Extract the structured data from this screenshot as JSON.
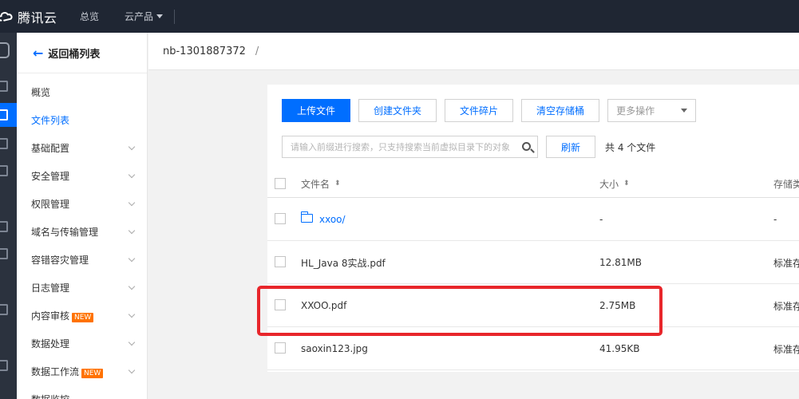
{
  "topbar": {
    "logo_text": "腾讯云",
    "nav_overview": "总览",
    "nav_products": "云产品"
  },
  "sidebar": {
    "back_label": "返回桶列表",
    "items": [
      {
        "label": "概览"
      },
      {
        "label": "文件列表",
        "active": true
      },
      {
        "label": "基础配置"
      },
      {
        "label": "安全管理"
      },
      {
        "label": "权限管理"
      },
      {
        "label": "域名与传输管理"
      },
      {
        "label": "容错容灾管理"
      },
      {
        "label": "日志管理"
      },
      {
        "label": "内容审核",
        "badge": "NEW"
      },
      {
        "label": "数据处理"
      },
      {
        "label": "数据工作流",
        "badge": "NEW"
      },
      {
        "label": "数据监控"
      }
    ]
  },
  "breadcrumb": {
    "bucket": "nb-1301887372",
    "separator": "/"
  },
  "toolbar": {
    "upload": "上传文件",
    "create_folder": "创建文件夹",
    "fragments": "文件碎片",
    "clear_bucket": "清空存储桶",
    "more_actions": "更多操作"
  },
  "search": {
    "placeholder": "请输入前缀进行搜索，只支持搜索当前虚拟目录下的对象",
    "refresh": "刷新",
    "count": "共 4 个文件"
  },
  "table": {
    "headers": {
      "name": "文件名",
      "size": "大小",
      "storage": "存储类"
    },
    "rows": [
      {
        "name": "xxoo/",
        "size": "-",
        "storage": "-",
        "is_folder": true
      },
      {
        "name": "HL_Java 8实战.pdf",
        "size": "12.81MB",
        "storage": "标准存"
      },
      {
        "name": "XXOO.pdf",
        "size": "2.75MB",
        "storage": "标准存"
      },
      {
        "name": "saoxin123.jpg",
        "size": "41.95KB",
        "storage": "标准存"
      }
    ]
  },
  "colors": {
    "accent": "#006eff",
    "topbar": "#1f2633",
    "highlight": "#e8262b",
    "badge": "#ff7200"
  }
}
